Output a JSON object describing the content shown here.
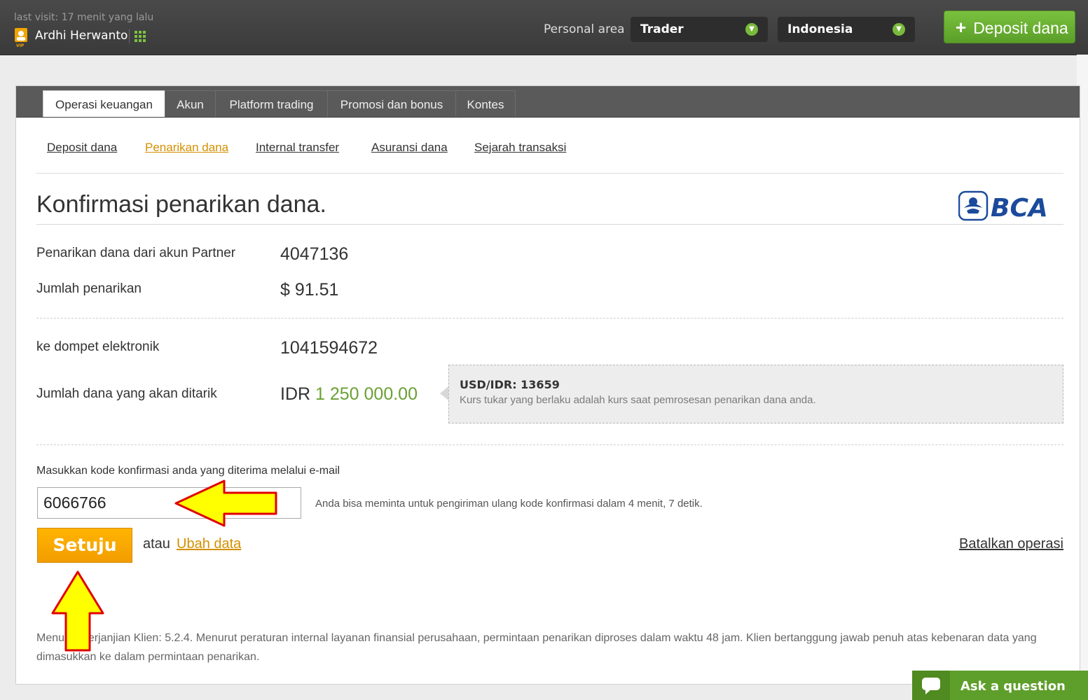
{
  "header": {
    "last_visit": "last visit: 17 menit yang lalu",
    "user_name": "Ardhi Herwanto",
    "personal_area_label": "Personal area",
    "account_type": "Trader",
    "country": "Indonesia",
    "deposit_label": "Deposit dana",
    "accent_green": "#7cc242"
  },
  "tabs": [
    {
      "label": "Operasi keuangan",
      "active": true
    },
    {
      "label": "Akun"
    },
    {
      "label": "Platform trading"
    },
    {
      "label": "Promosi dan bonus"
    },
    {
      "label": "Kontes"
    }
  ],
  "subnav": [
    {
      "label": "Deposit dana"
    },
    {
      "label": "Penarikan dana",
      "active": true
    },
    {
      "label": "Internal transfer"
    },
    {
      "label": "Asuransi dana"
    },
    {
      "label": "Sejarah transaksi"
    }
  ],
  "page": {
    "title": "Konfirmasi penarikan dana.",
    "bank_logo_text": "BCA",
    "rows": {
      "partner_label": "Penarikan dana dari akun Partner",
      "partner_value": "4047136",
      "amount_label": "Jumlah penarikan",
      "amount_value": "$ 91.51",
      "wallet_label": "ke dompet elektronik",
      "wallet_value": "1041594672",
      "withdraw_label": "Jumlah dana yang akan ditarik",
      "withdraw_currency": "IDR",
      "withdraw_amount": "1 250 000.00"
    },
    "rate": {
      "title": "USD/IDR: 13659",
      "desc": "Kurs tukar yang berlaku adalah kurs saat pemrosesan penarikan dana anda."
    },
    "code": {
      "label": "Masukkan kode konfirmasi anda yang diterima melalui e-mail",
      "value": "6066766",
      "resend_note": "Anda bisa meminta untuk pengiriman ulang kode konfirmasi dalam 4 menit, 7 detik."
    },
    "actions": {
      "agree": "Setuju",
      "or": "atau",
      "change": "Ubah data",
      "cancel": "Batalkan operasi"
    },
    "footnote": "Menurut Perjanjian Klien: 5.2.4. Menurut peraturan internal layanan finansial perusahaan, permintaan penarikan diproses dalam waktu 48 jam. Klien bertanggung jawab penuh atas kebenaran data yang dimasukkan ke dalam permintaan penarikan."
  },
  "chat": {
    "label": "Ask a question"
  }
}
